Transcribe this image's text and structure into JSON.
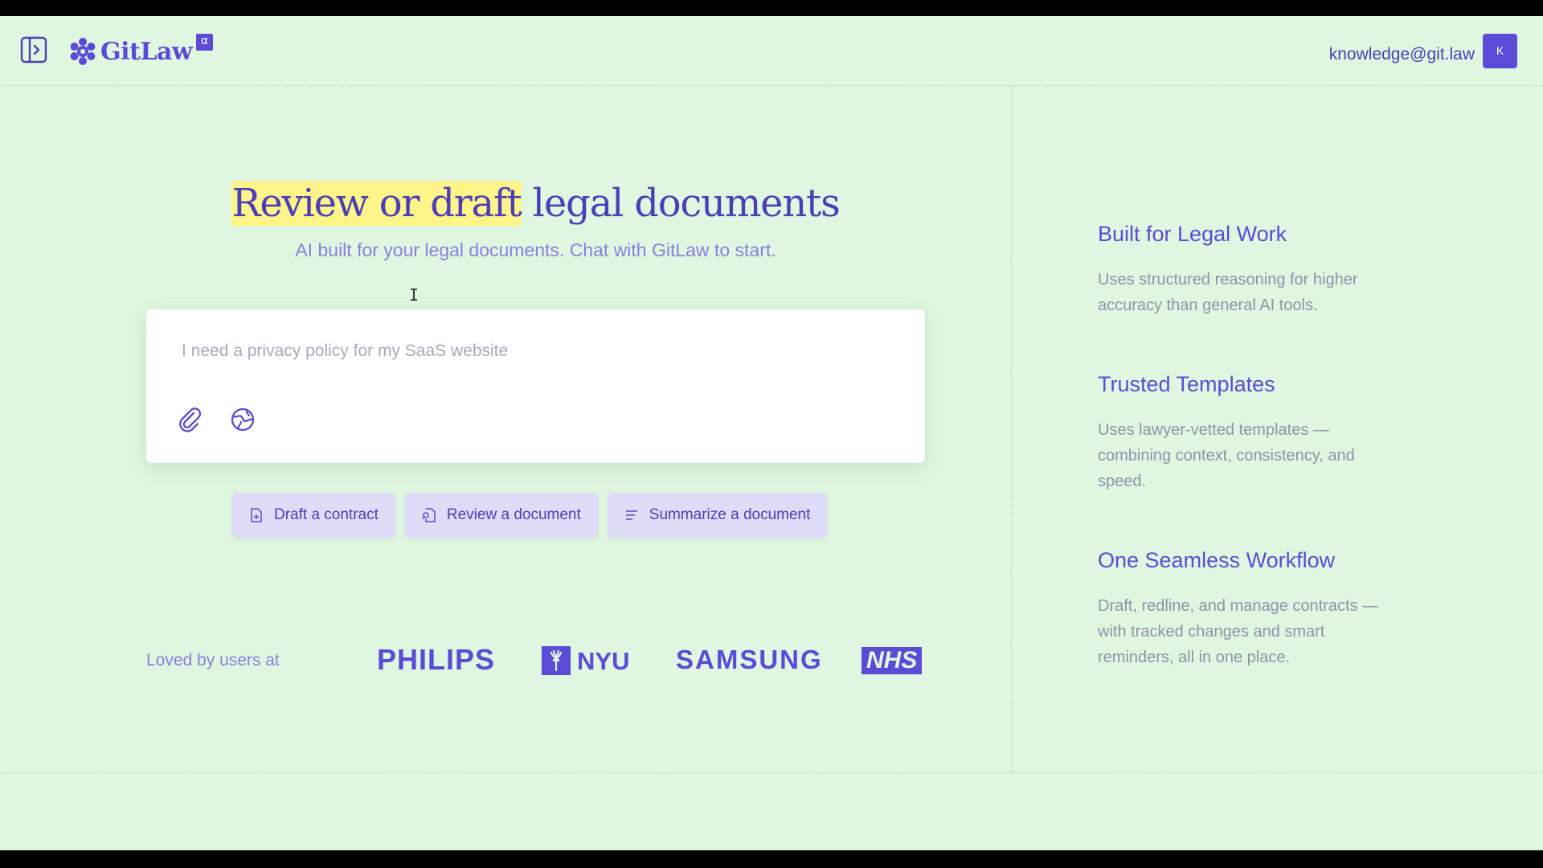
{
  "header": {
    "brand_name": "GitLaw",
    "brand_badge": "α",
    "user_email": "knowledge@git.law",
    "avatar_initial": "K"
  },
  "hero": {
    "title_highlight": "Review or draft",
    "title_rest": " legal documents",
    "subtitle": "AI built for your legal documents. Chat with GitLaw to start."
  },
  "chat": {
    "placeholder": "I need a privacy policy for my SaaS website",
    "value": ""
  },
  "suggestions": [
    {
      "label": "Draft a contract",
      "icon": "file-plus-icon"
    },
    {
      "label": "Review a document",
      "icon": "file-search-icon"
    },
    {
      "label": "Summarize a document",
      "icon": "lines-icon"
    }
  ],
  "social_proof": {
    "label": "Loved by users at",
    "brands": [
      "PHILIPS",
      "NYU",
      "SAMSUNG",
      "NHS"
    ]
  },
  "features": [
    {
      "title": "Built for Legal Work",
      "description": "Uses structured reasoning for higher accuracy than general AI tools."
    },
    {
      "title": "Trusted Templates",
      "description": "Uses lawyer-vetted templates — combining context, consistency, and speed."
    },
    {
      "title": "One Seamless Workflow",
      "description": "Draft, redline, and manage contracts — with tracked changes and smart reminders, all in one place."
    }
  ],
  "colors": {
    "background": "#dff7e0",
    "primary": "#5b4bd6",
    "highlight": "#fff489",
    "chip_bg": "#dedcf7",
    "muted_text": "#8f93a8"
  }
}
